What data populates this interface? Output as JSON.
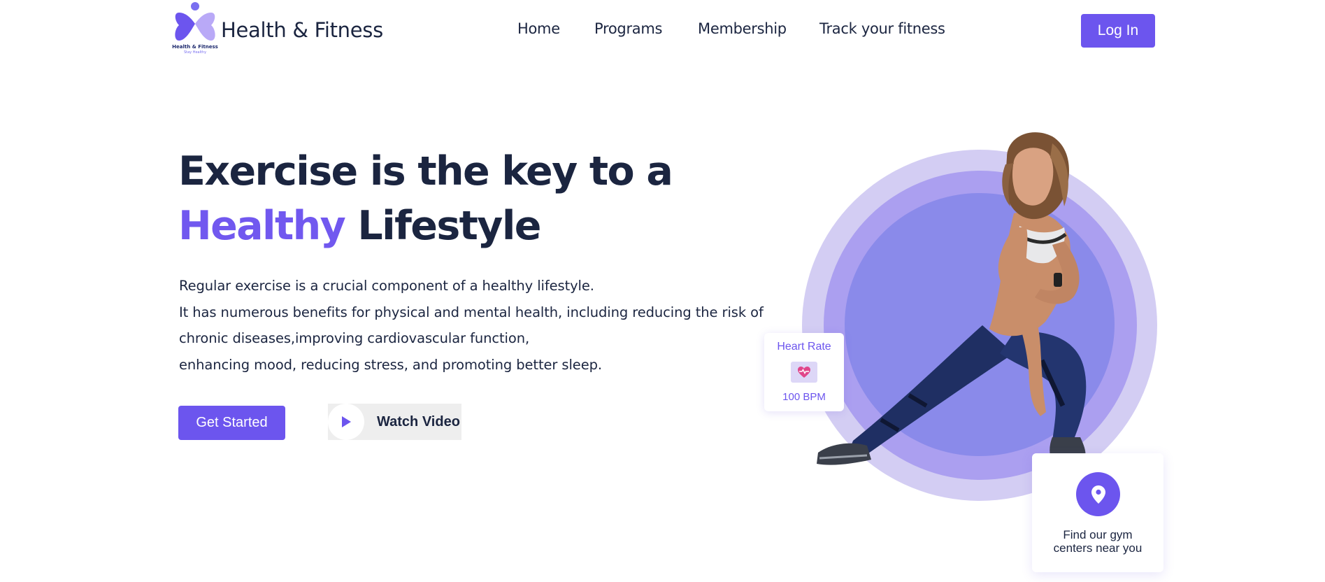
{
  "brand": {
    "logo_name": "Health & Fitness",
    "logo_tagline": "Stay Healthy",
    "title": "Health & Fitness",
    "accent_color": "#6c55ee"
  },
  "nav": {
    "items": [
      {
        "label": "Home"
      },
      {
        "label": "Programs"
      },
      {
        "label": "Membership"
      },
      {
        "label": "Track your fitness"
      }
    ],
    "login_label": "Log In"
  },
  "hero": {
    "headline_line1": "Exercise is the key to a",
    "headline_accent": "Healthy",
    "headline_rest": "Lifestyle",
    "paragraph_lines": [
      "Regular exercise is a crucial component of a healthy lifestyle.",
      "It has numerous benefits for physical and mental health, including reducing the risk of",
      "chronic diseases,improving cardiovascular function,",
      "enhancing mood, reducing stress, and promoting better sleep."
    ],
    "get_started_label": "Get Started",
    "watch_video_label": "Watch Video"
  },
  "heart_rate_card": {
    "title": "Heart Rate",
    "value": "100 BPM",
    "icon": "heart-pulse-icon"
  },
  "gym_card": {
    "text_line1": "Find our gym",
    "text_line2": "centers near you",
    "icon": "location-pin-icon"
  }
}
